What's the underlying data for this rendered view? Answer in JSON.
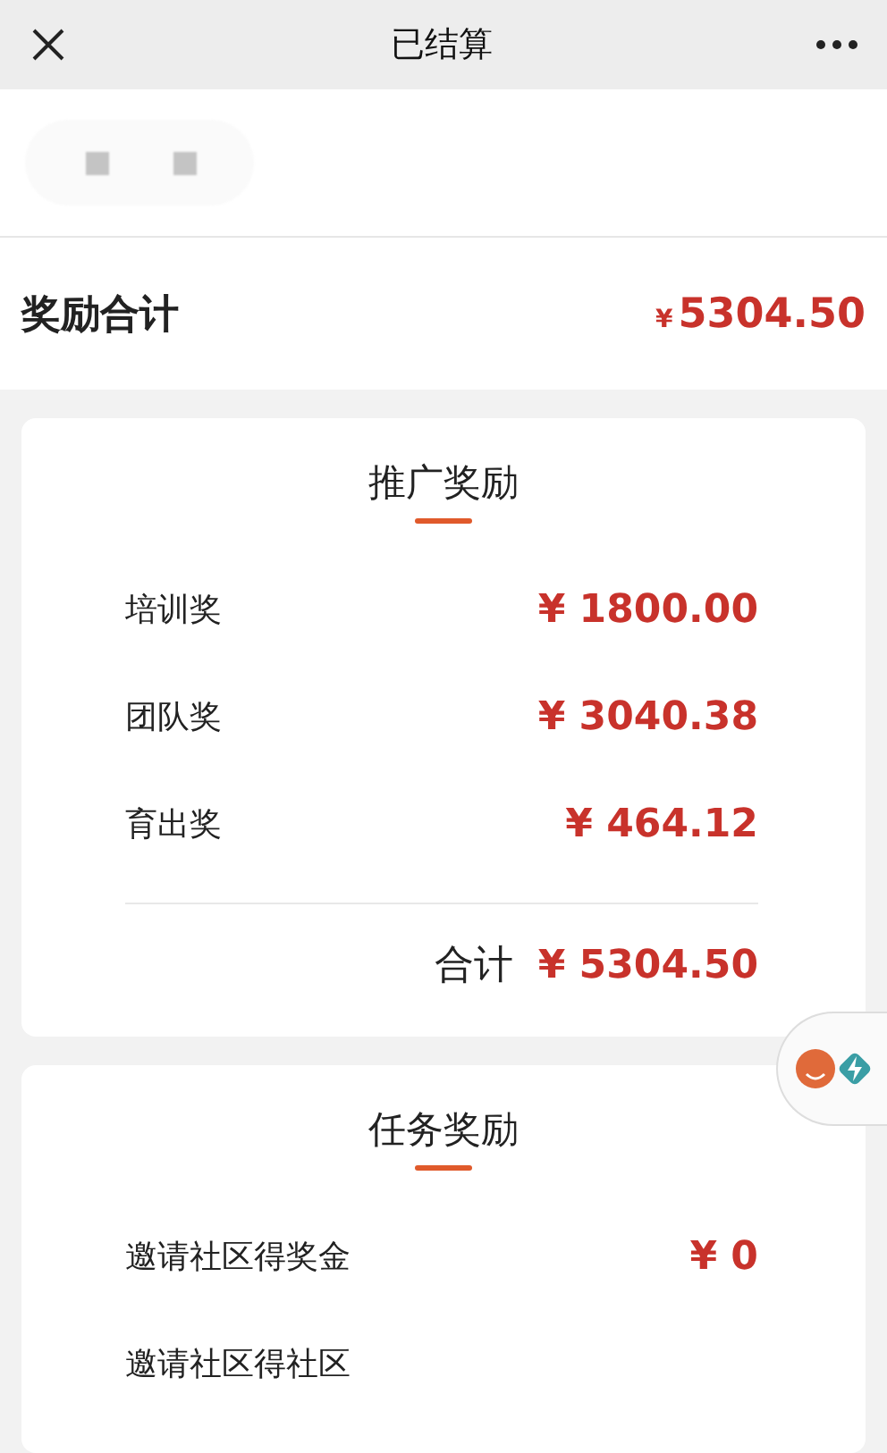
{
  "nav": {
    "title": "已结算"
  },
  "total": {
    "label": "奖励合计",
    "currency": "¥",
    "amount": "5304.50"
  },
  "sections": [
    {
      "title": "推广奖励",
      "rows": [
        {
          "label": "培训奖",
          "value": "¥ 1800.00"
        },
        {
          "label": "团队奖",
          "value": "¥ 3040.38"
        },
        {
          "label": "育出奖",
          "value": "¥ 464.12"
        }
      ],
      "sum": {
        "label": "合计",
        "value": "¥ 5304.50"
      }
    },
    {
      "title": "任务奖励",
      "rows": [
        {
          "label": "邀请社区得奖金",
          "value": "¥ 0"
        },
        {
          "label": "邀请社区得社区"
        }
      ]
    }
  ]
}
